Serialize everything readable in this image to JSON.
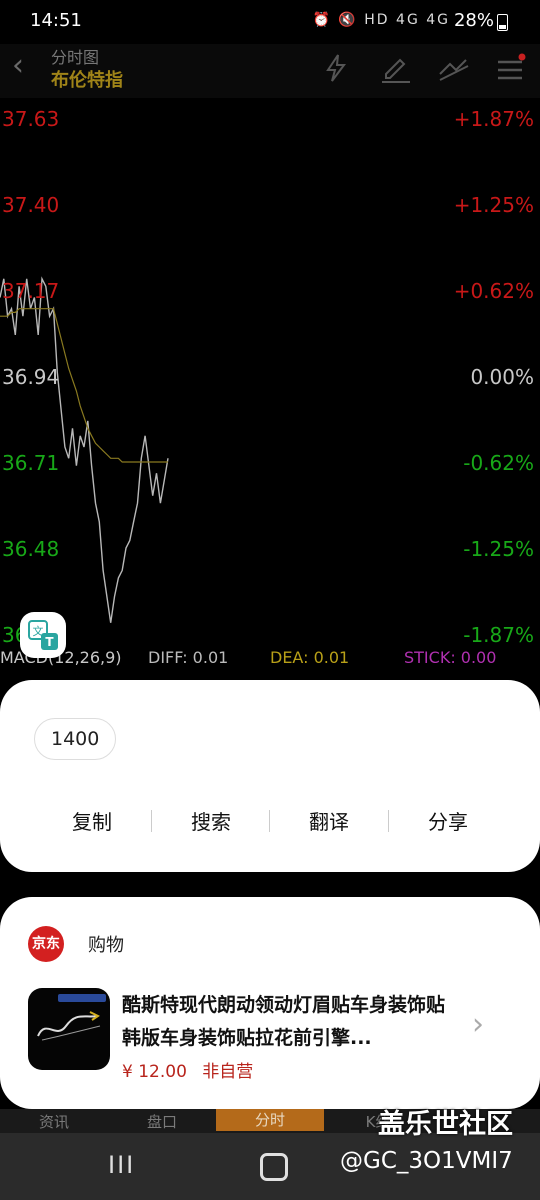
{
  "status": {
    "time": "14:51",
    "icons": "⏰ 🔇 HD 4G 4G",
    "battery": "28%"
  },
  "header": {
    "subtitle": "分时图",
    "title": "布伦特指"
  },
  "chart": {
    "left_labels": [
      "37.63",
      "37.40",
      "37.17",
      "36.94",
      "36.71",
      "36.48",
      "36.25"
    ],
    "right_labels": [
      "+1.87%",
      "+1.25%",
      "+0.62%",
      "0.00%",
      "-0.62%",
      "-1.25%",
      "-1.87%"
    ],
    "left_colors": [
      "#c81818",
      "#c81818",
      "#c81818",
      "#c8c8c8",
      "#18a818",
      "#18a818",
      "#18a818"
    ]
  },
  "chart_data": {
    "type": "line",
    "title": "",
    "ylim": [
      36.25,
      37.63
    ],
    "series": [
      {
        "values": [
          37.15,
          37.2,
          37.1,
          37.12,
          37.05,
          37.18,
          37.1,
          37.2,
          37.12,
          37.15,
          37.05,
          37.2,
          37.18,
          37.1,
          37.12,
          36.95,
          36.85,
          36.75,
          36.72,
          36.8,
          36.7,
          36.78,
          36.75,
          36.82,
          36.7,
          36.6,
          36.55,
          36.42,
          36.35,
          36.28,
          36.35,
          36.4,
          36.42,
          36.48,
          36.5,
          36.55,
          36.6,
          36.72,
          36.78,
          36.7,
          36.62,
          36.68,
          36.6,
          36.66,
          36.72
        ]
      },
      {
        "values": [
          37.1,
          37.1,
          37.1,
          37.11,
          37.11,
          37.12,
          37.12,
          37.12,
          37.12,
          37.12,
          37.12,
          37.12,
          37.12,
          37.12,
          37.12,
          37.08,
          37.04,
          37.0,
          36.96,
          36.93,
          36.9,
          36.86,
          36.83,
          36.8,
          36.78,
          36.76,
          36.75,
          36.74,
          36.73,
          36.72,
          36.72,
          36.72,
          36.71,
          36.71,
          36.71,
          36.71,
          36.71,
          36.71,
          36.71,
          36.71,
          36.71,
          36.71,
          36.71,
          36.71,
          36.71
        ]
      }
    ]
  },
  "macd": {
    "label": "MACD(12,26,9)",
    "diff": "DIFF: 0.01",
    "dea": "DEA: 0.01",
    "stick": "STICK: 0.00"
  },
  "selection": {
    "chip": "1400",
    "actions": [
      "复制",
      "搜索",
      "翻译",
      "分享"
    ]
  },
  "shopping": {
    "brand": "京东",
    "label": "购物",
    "product_title": "酷斯特现代朗动领动灯眉贴车身装饰贴 韩版车身装饰贴拉花前引擎...",
    "price": "¥ 12.00",
    "seller": "非自营"
  },
  "tabs": [
    "资讯",
    "盘口",
    "分时",
    "K线",
    ""
  ],
  "watermark": {
    "line1": "盖乐世社区",
    "line2": "@GC_3O1VMI7"
  },
  "colors": {
    "rise": "#c81818",
    "fall": "#18a818",
    "avg": "#8a7a20",
    "accent": "#a08418"
  }
}
